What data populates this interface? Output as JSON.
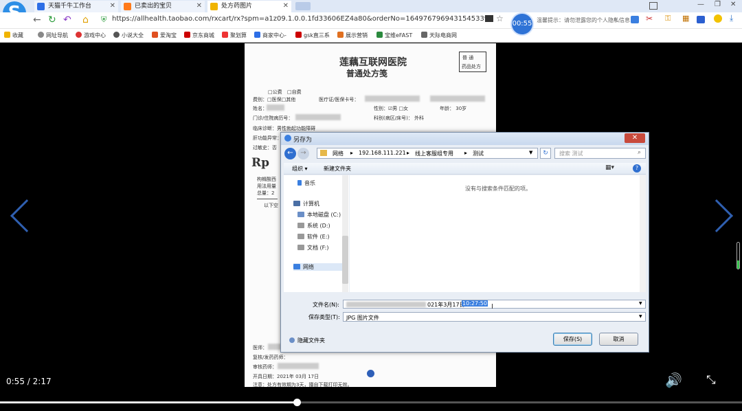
{
  "browser": {
    "tabs": [
      {
        "label": "天猫千牛工作台",
        "color": "#2d6ee6"
      },
      {
        "label": "已卖出的宝贝",
        "color": "#ff7a1a"
      },
      {
        "label": "处方药图片",
        "color": "#f0b400"
      }
    ],
    "url": "https://allhealth.taobao.com/rxcart/rx?spm=a1z09.1.0.0.1fd33606EZ4a80&orderNo=1649767969431545339",
    "notice": "温馨提示：请勿泄露您的个人隐私信息",
    "bookmarks": [
      "收藏",
      "网址导航",
      "游戏中心",
      "小说大全",
      "爱淘宝",
      "京东商城",
      "聚划算",
      "商家中心-",
      "gsk直三系",
      "展示营销",
      "宝维eFAST",
      "天际电商网"
    ]
  },
  "timer": "00:55",
  "prescription": {
    "hospital": "莲藕互联网医院",
    "doc_title": "普通处方笺",
    "badge_line1": "普    通",
    "badge_line2": "药品处方",
    "fee_public": "公费",
    "fee_self": "自费",
    "fee_label": "费别：",
    "fee_insurance": "医保",
    "fee_other": "其他",
    "card_label": "医疗证/医保卡号：",
    "name_label": "姓名：",
    "gender_label": "性别：",
    "gender_male": "男",
    "gender_female": "女",
    "age_label": "年龄：",
    "age_value": "30岁",
    "record_label": "门诊/住院病历号：",
    "dept_label": "科别(病区/床号)：",
    "dept_value": "外科",
    "diagnosis_label": "临床诊断：",
    "diagnosis_value": "男性勃起功能障碍",
    "liver_label": "肝功能异常：",
    "allergy_label": "过敏史：",
    "allergy_value": "否",
    "rp": "Rp",
    "drug_line1": "枸橼酸西",
    "drug_line2": "用法用量",
    "drug_line3": "总量：2",
    "drug_line4": "以下空",
    "physician_label": "医师：",
    "dispense_label": "复核/发药药师：",
    "review_label": "审核药师：",
    "date_label": "开具日期：",
    "date_year": "2021年",
    "date_month": "03月",
    "date_day": "17日",
    "footer_note": "注意：处方有效期为3天，擅自下载打印无效。"
  },
  "dialog": {
    "title": "另存为",
    "path": [
      "网络",
      "192.168.111.221",
      "线上客服组专用",
      "测试"
    ],
    "search_placeholder": "搜索 测试",
    "organize": "组织 ▾",
    "new_folder": "新建文件夹",
    "nav_items": [
      "音乐",
      "计算机",
      "本地磁盘 (C:)",
      "系统 (D:)",
      "软件 (E:)",
      "文档 (F:)",
      "网络"
    ],
    "empty_message": "没有与搜索条件匹配的项。",
    "filename_label": "文件名(N):",
    "filename_value": "021年3月17日",
    "filename_selected": "10:27:50",
    "filetype_label": "保存类型(T):",
    "filetype_value": "JPG 图片文件",
    "hide_folders": "隐藏文件夹",
    "save": "保存(S)",
    "cancel": "取消"
  },
  "player": {
    "current": "0:55",
    "separator": "/",
    "duration": "2:17",
    "progress": 0.4
  }
}
